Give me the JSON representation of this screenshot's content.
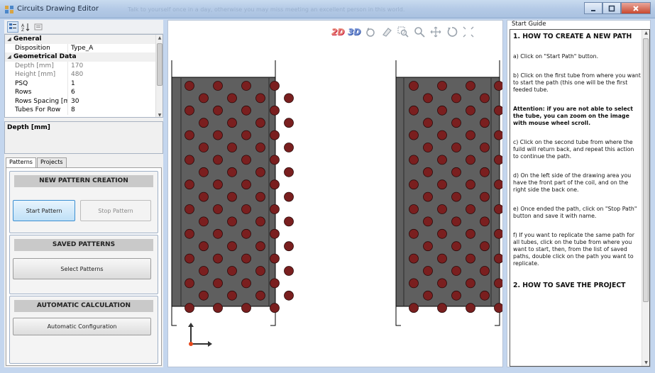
{
  "window": {
    "title": "Circuits Drawing Editor",
    "title_blur": "Talk to yourself once in a day, otherwise you may miss meeting an excellent person in this world."
  },
  "property_grid": {
    "rows": [
      {
        "kind": "category",
        "label": "General"
      },
      {
        "kind": "prop",
        "key": "Disposition",
        "value": "Type_A",
        "enabled": true
      },
      {
        "kind": "category",
        "label": "Geometrical Data"
      },
      {
        "kind": "prop",
        "key": "Depth [mm]",
        "value": "170",
        "enabled": false
      },
      {
        "kind": "prop",
        "key": "Height [mm]",
        "value": "480",
        "enabled": false
      },
      {
        "kind": "prop",
        "key": "PSQ",
        "value": "1",
        "enabled": true
      },
      {
        "kind": "prop",
        "key": "Rows",
        "value": "6",
        "enabled": true
      },
      {
        "kind": "prop",
        "key": "Rows Spacing [mm",
        "value": "30",
        "enabled": true
      },
      {
        "kind": "prop",
        "key": "Tubes For Row",
        "value": "8",
        "enabled": true
      }
    ],
    "description_title": "Depth [mm]"
  },
  "tabs": [
    {
      "label": "Patterns",
      "active": true
    },
    {
      "label": "Projects",
      "active": false
    }
  ],
  "patterns": {
    "new_section_title": "NEW PATTERN CREATION",
    "start_label": "Start Pattern",
    "stop_label": "Stop Pattern",
    "saved_section_title": "SAVED PATTERNS",
    "select_label": "Select Patterns",
    "auto_section_title": "AUTOMATIC CALCULATION",
    "auto_label": "Automatic Configuration"
  },
  "toolbar": {
    "view_2d": "2D",
    "view_3d": "3D"
  },
  "guide": {
    "panel_title": "Start Guide",
    "heading1": "1. HOW TO CREATE A NEW PATH",
    "paragraphs": [
      {
        "text": "a) Click on \"Start Path\" button.",
        "bold": false
      },
      {
        "text": "b) Click on the first tube from where you want to start the path (this one will be the first feeded tube.",
        "bold": false
      },
      {
        "text": "Attention: if you are not able to select the tube, you can zoom on the image with mouse wheel scroll.",
        "bold": true
      },
      {
        "text": "c) Click on the second tube from where the fuild will return back, and repeat this action to continue the path.",
        "bold": false
      },
      {
        "text": "d) On the left side of the drawing area you have the front part of the coil, and on the right side the back one.",
        "bold": false
      },
      {
        "text": "e) Once ended the path, click on \"Stop Path\" button and save it with name.",
        "bold": false
      },
      {
        "text": "f) If you want to replicate the same path for all tubes, click on the tube from where you want to start, then, from the list of saved paths, double click on the path you want to replicate.",
        "bold": false
      }
    ],
    "heading2": "2. HOW TO SAVE THE PROJECT"
  },
  "colors": {
    "coil_fill": "#5f5f5f",
    "tube_fill": "#7a1f1f",
    "accent_blue": "#3c8fd1"
  },
  "icons": {
    "app": "circuit-app-icon",
    "sort_categorized": "categorized-icon",
    "sort_alpha": "alphabetical-sort-icon",
    "property_pages": "property-pages-icon",
    "view_2d": "view-2d-icon",
    "view_3d": "view-3d-icon",
    "rotate": "rotate-view-icon",
    "eraser": "eraser-icon",
    "zoom_window": "zoom-window-icon",
    "zoom": "zoom-icon",
    "pan": "pan-icon",
    "reset": "reset-view-icon",
    "fit": "fit-extent-icon"
  }
}
